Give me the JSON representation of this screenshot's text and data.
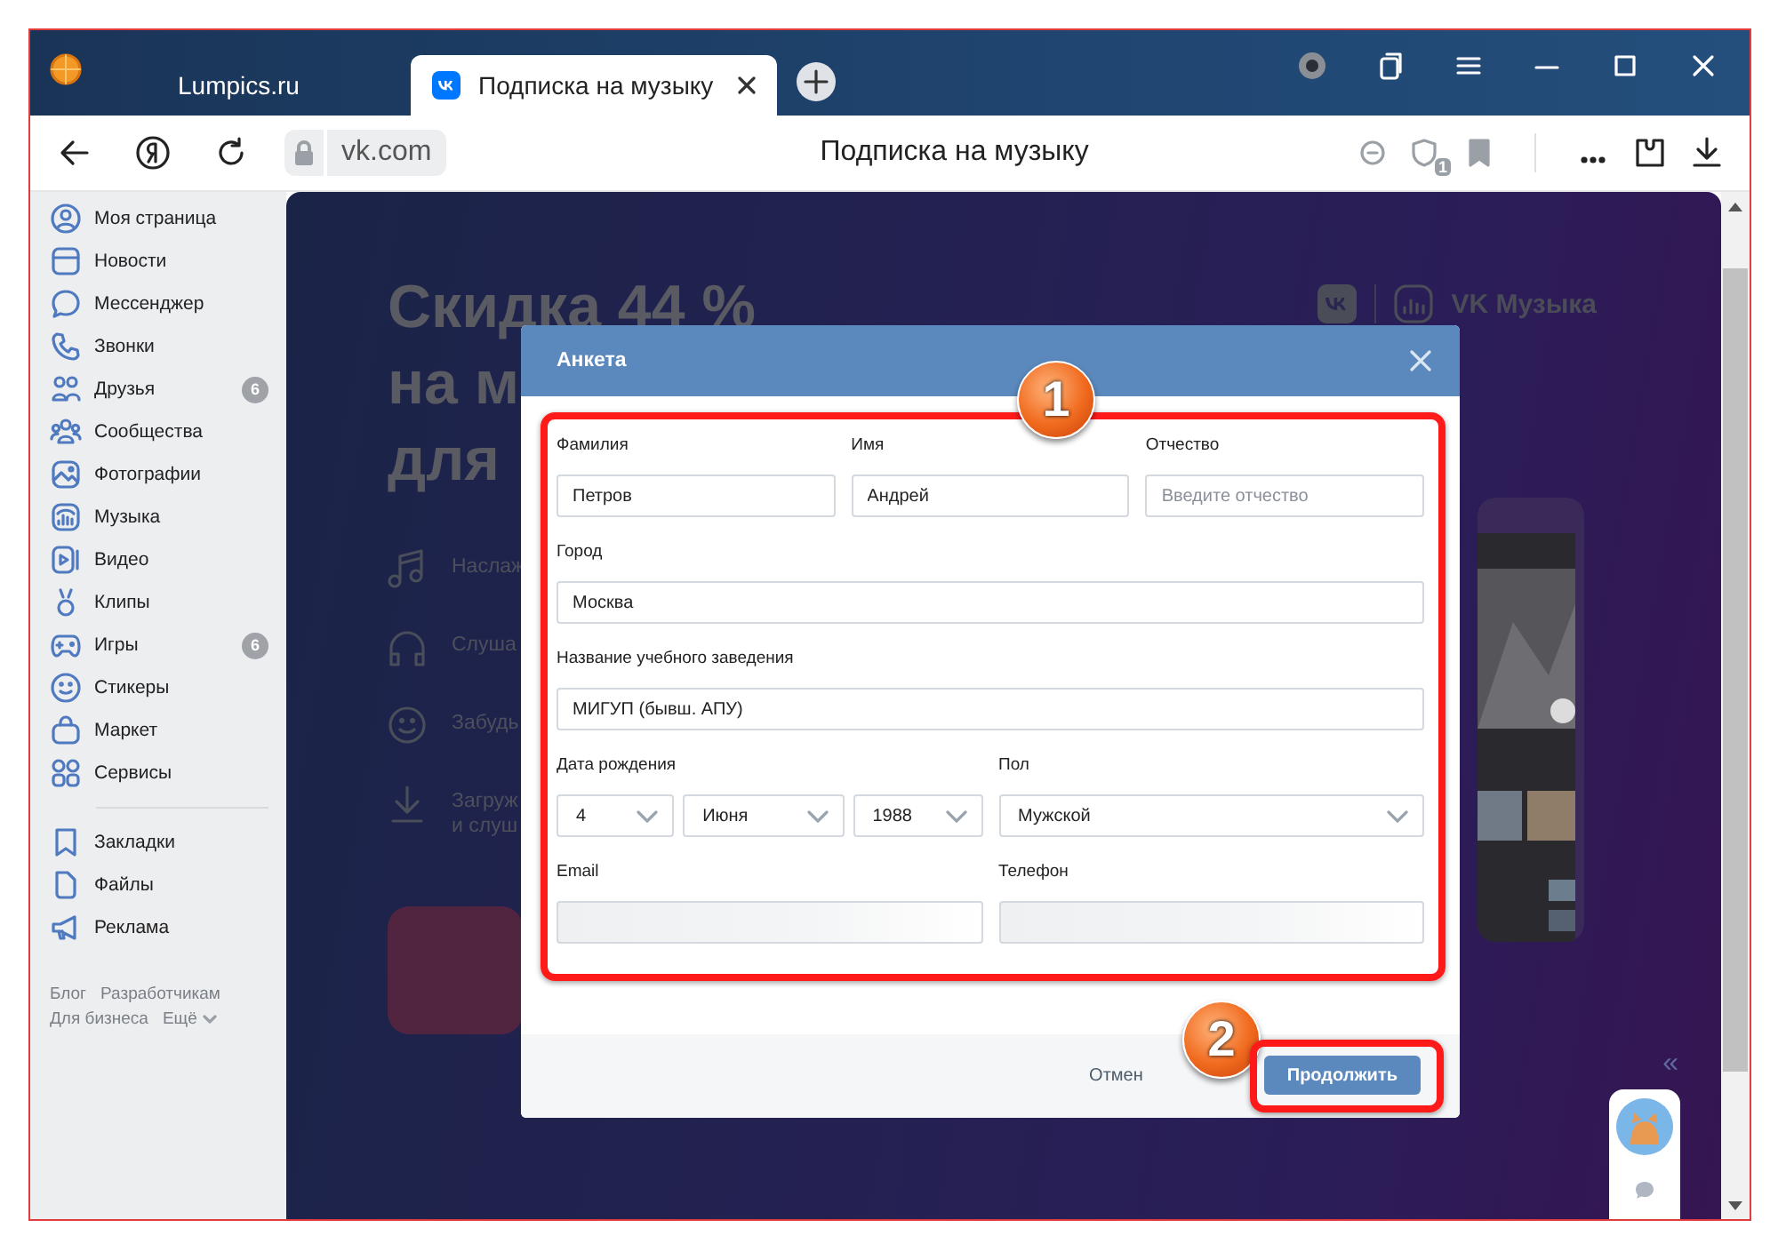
{
  "browser": {
    "tabs": [
      {
        "title": "Lumpics.ru",
        "selected": false
      },
      {
        "title": "Подписка на музыку",
        "selected": true
      }
    ],
    "address": "vk.com",
    "page_title": "Подписка на музыку",
    "extension_count": "1"
  },
  "sidebar": {
    "items": [
      {
        "label": "Моя страница"
      },
      {
        "label": "Новости"
      },
      {
        "label": "Мессенджер"
      },
      {
        "label": "Звонки"
      },
      {
        "label": "Друзья",
        "badge": "6"
      },
      {
        "label": "Сообщества"
      },
      {
        "label": "Фотографии"
      },
      {
        "label": "Музыка"
      },
      {
        "label": "Видео"
      },
      {
        "label": "Клипы"
      },
      {
        "label": "Игры",
        "badge": "6"
      },
      {
        "label": "Стикеры"
      },
      {
        "label": "Маркет"
      },
      {
        "label": "Сервисы"
      }
    ],
    "more_items": [
      {
        "label": "Закладки"
      },
      {
        "label": "Файлы"
      },
      {
        "label": "Реклама"
      }
    ],
    "footer_links": [
      "Блог",
      "Разработчикам",
      "Для бизнеса",
      "Ещё"
    ]
  },
  "promo": {
    "headline": [
      "Скидка 44 %",
      "на м",
      "для"
    ],
    "brand": "VK Музыка",
    "features": [
      {
        "text": "Наслаж"
      },
      {
        "text": "Слуша"
      },
      {
        "text": "Забудь"
      },
      {
        "text": "Загруж\nи слуш"
      }
    ]
  },
  "dialog": {
    "title": "Анкета",
    "rows": [
      [
        {
          "label": "Фамилия",
          "value": "Петров"
        },
        {
          "label": "Имя",
          "value": "Андрей"
        },
        {
          "label": "Отчество",
          "placeholder": "Введите отчество"
        }
      ],
      [
        {
          "label": "Город",
          "value": "Москва"
        }
      ],
      [
        {
          "label": "Название учебного заведения",
          "value": "МИГУП (бывш. АПУ)"
        }
      ],
      [
        {
          "label": "Дата рождения",
          "kind": "date",
          "parts": [
            "4",
            "Июня",
            "1988"
          ]
        },
        {
          "label": "Пол",
          "kind": "select",
          "value": "Мужской"
        }
      ],
      [
        {
          "label": "Email",
          "kind": "blurred"
        },
        {
          "label": "Телефон",
          "kind": "blurred"
        }
      ]
    ],
    "cancel": "Отмен",
    "submit": "Продолжить"
  },
  "annotations": [
    {
      "number": "1"
    },
    {
      "number": "2"
    }
  ],
  "collapse": "«"
}
